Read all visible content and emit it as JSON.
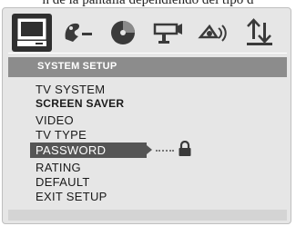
{
  "caption": "n de la pantalla dependiendo del tipo d",
  "toolbar": {
    "icons": [
      {
        "name": "system-monitor-icon",
        "selected": true
      },
      {
        "name": "language-icon",
        "selected": false
      },
      {
        "name": "audio-disc-icon",
        "selected": false
      },
      {
        "name": "video-icon",
        "selected": false
      },
      {
        "name": "speaker-icon",
        "selected": false
      },
      {
        "name": "preference-icon",
        "selected": false
      }
    ]
  },
  "section": {
    "title": "SYSTEM SETUP"
  },
  "menu": {
    "items": [
      {
        "label": "TV SYSTEM"
      },
      {
        "label": "SCREEN SAVER"
      },
      {
        "label": "VIDEO"
      },
      {
        "label": "TV TYPE"
      },
      {
        "label": "PASSWORD"
      },
      {
        "label": "RATING"
      },
      {
        "label": "DEFAULT"
      },
      {
        "label": "EXIT SETUP"
      }
    ],
    "selected_index": 4
  },
  "colors": {
    "panel": "#e6e6e6",
    "header": "#8c8c8c",
    "selected": "#555555"
  }
}
